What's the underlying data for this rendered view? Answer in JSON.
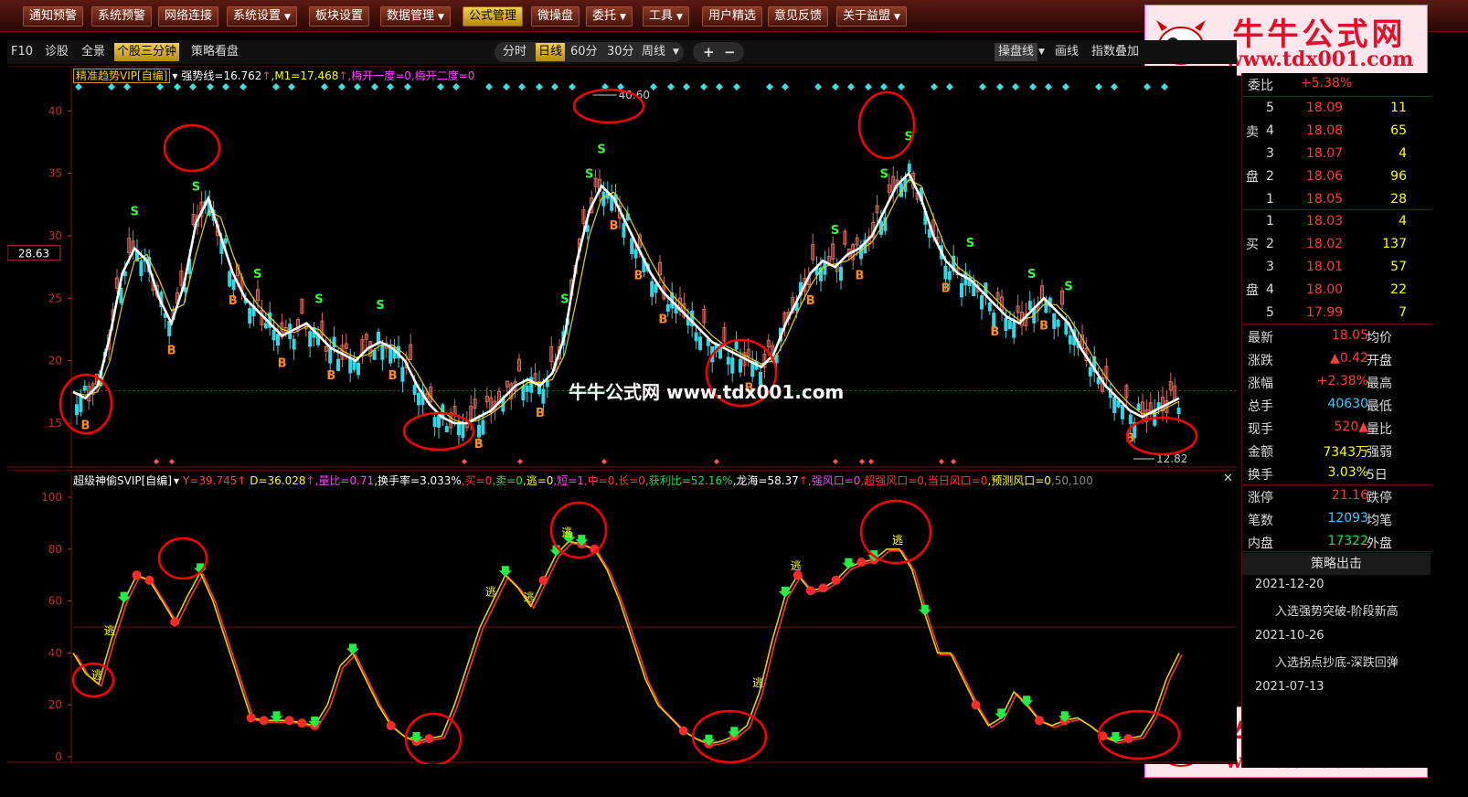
{
  "menu": [
    {
      "label": "通知预警",
      "active": false,
      "arrow": false
    },
    {
      "label": "系统预警",
      "active": false,
      "arrow": false
    },
    {
      "label": "网络连接",
      "active": false,
      "arrow": false
    },
    {
      "label": "系统设置",
      "active": false,
      "arrow": true
    },
    {
      "label": "板块设置",
      "active": false,
      "arrow": false
    },
    {
      "label": "数据管理",
      "active": false,
      "arrow": true
    },
    {
      "label": "公式管理",
      "active": true,
      "arrow": false
    },
    {
      "label": "微操盘",
      "active": false,
      "arrow": false
    },
    {
      "label": "委托",
      "active": false,
      "arrow": true
    },
    {
      "label": "工具",
      "active": false,
      "arrow": true
    },
    {
      "label": "用户精选",
      "active": false,
      "arrow": false
    },
    {
      "label": "意见反馈",
      "active": false,
      "arrow": false
    },
    {
      "label": "关于益盟",
      "active": false,
      "arrow": true
    }
  ],
  "logo": {
    "title": "牛牛公式网",
    "url": "www.tdx001.com"
  },
  "center_watermark": "牛牛公式网 www.tdx001.com",
  "toolbar": {
    "left_tabs": [
      "F10",
      "诊股",
      "全景",
      "个股三分钟",
      "策略看盘"
    ],
    "active_tab": "个股三分钟",
    "period_tabs": [
      "分时",
      "日线",
      "60分",
      "30分",
      "周线"
    ],
    "active_period": "日线",
    "plus": "+",
    "minus": "−",
    "right_tabs": [
      "操盘线",
      "画线",
      "指数叠加"
    ]
  },
  "top_panel": {
    "indicator_name": "精准趋势VIP[自编]",
    "stats": [
      {
        "text": "强势线=16.762",
        "color": "#ffffff"
      },
      {
        "text": "↑",
        "color": "#ff3b3b"
      },
      {
        "text": ",M1=17.468",
        "color": "#ffff00"
      },
      {
        "text": "↑",
        "color": "#ff3b3b"
      },
      {
        "text": ",梅开一度=0,梅开二度=0",
        "color": "#ff40ff"
      }
    ],
    "current_price_label": "28.63",
    "high_label": "40.60",
    "low_label": "12.82",
    "y_ticks": [
      "15",
      "20",
      "25",
      "30",
      "35",
      "40"
    ]
  },
  "bottom_panel": {
    "indicator_name": "超级神偷SVIP[自编]",
    "stats": [
      {
        "text": "Y=39.745",
        "color": "#ff3b3b"
      },
      {
        "text": "↑",
        "color": "#ff3b3b"
      },
      {
        "text": " D=36.028",
        "color": "#ffff00"
      },
      {
        "text": "↑",
        "color": "#ff3b3b"
      },
      {
        "text": ",量比=0.71",
        "color": "#ff40ff"
      },
      {
        "text": ",换手率=3.033%",
        "color": "#ffffff"
      },
      {
        "text": ",买=0",
        "color": "#ff3b3b"
      },
      {
        "text": ",卖=0",
        "color": "#00e65c"
      },
      {
        "text": ",逃=0",
        "color": "#ffff00"
      },
      {
        "text": ",短=1",
        "color": "#ff40ff"
      },
      {
        "text": ",中=0",
        "color": "#ff3b3b"
      },
      {
        "text": ",长=0",
        "color": "#ff3b3b"
      },
      {
        "text": ",获利比=52.16%",
        "color": "#00e65c"
      },
      {
        "text": ",龙海=58.37",
        "color": "#ffffff"
      },
      {
        "text": "↑",
        "color": "#ff3b3b"
      },
      {
        "text": ",强风口=0",
        "color": "#ff40ff"
      },
      {
        "text": ",超强风口=0",
        "color": "#ff3b3b"
      },
      {
        "text": ",当日风口=0",
        "color": "#ff3b3b"
      },
      {
        "text": ",预测风口=0",
        "color": "#ffff00"
      },
      {
        "text": ",50,100",
        "color": "#888888"
      }
    ],
    "y_ticks": [
      "0",
      "20",
      "40",
      "60",
      "80",
      "100"
    ],
    "close": "✕"
  },
  "order_book": {
    "weibi_label": "委比",
    "weibi_value": "+5.38%",
    "sell_label": "卖盘",
    "buy_label": "买盘",
    "sells": [
      {
        "n": "5",
        "price": "18.09",
        "vol": "11"
      },
      {
        "n": "4",
        "price": "18.08",
        "vol": "65"
      },
      {
        "n": "3",
        "price": "18.07",
        "vol": "4"
      },
      {
        "n": "2",
        "price": "18.06",
        "vol": "96"
      },
      {
        "n": "1",
        "price": "18.05",
        "vol": "28"
      }
    ],
    "buys": [
      {
        "n": "1",
        "price": "18.03",
        "vol": "4"
      },
      {
        "n": "2",
        "price": "18.02",
        "vol": "137"
      },
      {
        "n": "3",
        "price": "18.01",
        "vol": "57"
      },
      {
        "n": "4",
        "price": "18.00",
        "vol": "22"
      },
      {
        "n": "5",
        "price": "17.99",
        "vol": "7"
      }
    ]
  },
  "quote": [
    {
      "l": "最新",
      "v": "18.05",
      "vc": "#ff3b3b",
      "r": "均价"
    },
    {
      "l": "涨跌",
      "v": "▲0.42",
      "vc": "#ff3b3b",
      "r": "开盘"
    },
    {
      "l": "涨幅",
      "v": "+2.38%",
      "vc": "#ff3b3b",
      "r": "最高"
    },
    {
      "l": "总手",
      "v": "40630",
      "vc": "#33ccff",
      "r": "最低"
    },
    {
      "l": "现手",
      "v": "520▲",
      "vc": "#ff3b3b",
      "r": "量比"
    },
    {
      "l": "金额",
      "v": "7343万",
      "vc": "#ffff00",
      "r": "强弱"
    },
    {
      "l": "换手",
      "v": "3.03%",
      "vc": "#ffff00",
      "r": "5日"
    },
    {
      "l": "涨停",
      "v": "21.16",
      "vc": "#ff3b3b",
      "r": "跌停"
    },
    {
      "l": "笔数",
      "v": "12093",
      "vc": "#33ccff",
      "r": "均笔"
    },
    {
      "l": "内盘",
      "v": "17322",
      "vc": "#00e65c",
      "r": "外盘"
    }
  ],
  "strategy": {
    "title": "策略出击",
    "items": [
      {
        "date": "2021-12-20",
        "text": "入选强势突破-阶段新高"
      },
      {
        "date": "2021-10-26",
        "text": "入选拐点抄底-深跌回弹"
      },
      {
        "date": "2021-07-13",
        "text": ""
      }
    ]
  },
  "colors": {
    "menu_bg": "#5a1a12",
    "active": "#f1d24a",
    "up": "#ff3b3b",
    "down": "#33ccff",
    "trend": "#ffffff",
    "ma": "#ffff00",
    "circle": "#ff0000"
  },
  "chart_data": [
    {
      "type": "line",
      "title": "精准趋势VIP[自编]",
      "ylim": [
        12,
        42
      ],
      "series": [
        {
          "name": "强势线",
          "values": [
            17.5,
            17,
            18,
            22,
            27,
            29,
            28,
            25,
            23,
            26,
            31,
            33,
            30,
            27,
            25,
            24,
            23,
            22,
            22.5,
            23,
            22,
            21,
            20.5,
            20,
            21,
            21.5,
            21,
            20,
            18,
            16.5,
            15.5,
            15,
            15,
            15.5,
            16,
            17,
            18,
            18.5,
            18,
            19,
            22,
            28,
            32,
            34,
            33,
            31,
            29,
            27,
            25.5,
            24.5,
            23.5,
            22.5,
            21.5,
            21,
            20.5,
            20,
            19.5,
            20.5,
            23,
            25,
            27,
            28,
            27.5,
            28.5,
            29,
            30,
            32,
            34,
            35,
            33,
            30,
            28,
            27,
            26.5,
            25.5,
            24.5,
            23.5,
            23,
            24,
            25,
            24,
            23,
            21,
            19.5,
            18,
            17,
            16,
            15.5,
            16,
            16.5,
            17
          ]
        }
      ]
    },
    {
      "type": "line",
      "title": "超级神偷SVIP[自编]",
      "ylim": [
        0,
        100
      ],
      "series": [
        {
          "name": "Y",
          "values": [
            40,
            32,
            28,
            45,
            60,
            70,
            68,
            60,
            52,
            62,
            71,
            60,
            45,
            30,
            15,
            14,
            14,
            14,
            13,
            12,
            20,
            35,
            40,
            30,
            20,
            12,
            8,
            6,
            7,
            8,
            20,
            35,
            50,
            60,
            70,
            65,
            58,
            68,
            78,
            83,
            82,
            80,
            72,
            60,
            45,
            30,
            20,
            15,
            10,
            7,
            5,
            6,
            8,
            12,
            25,
            45,
            62,
            70,
            64,
            65,
            68,
            73,
            75,
            76,
            80,
            80,
            72,
            55,
            40,
            40,
            30,
            20,
            12,
            15,
            25,
            20,
            14,
            12,
            14,
            15,
            12,
            8,
            6,
            7,
            8,
            16,
            30,
            40
          ]
        }
      ]
    }
  ]
}
